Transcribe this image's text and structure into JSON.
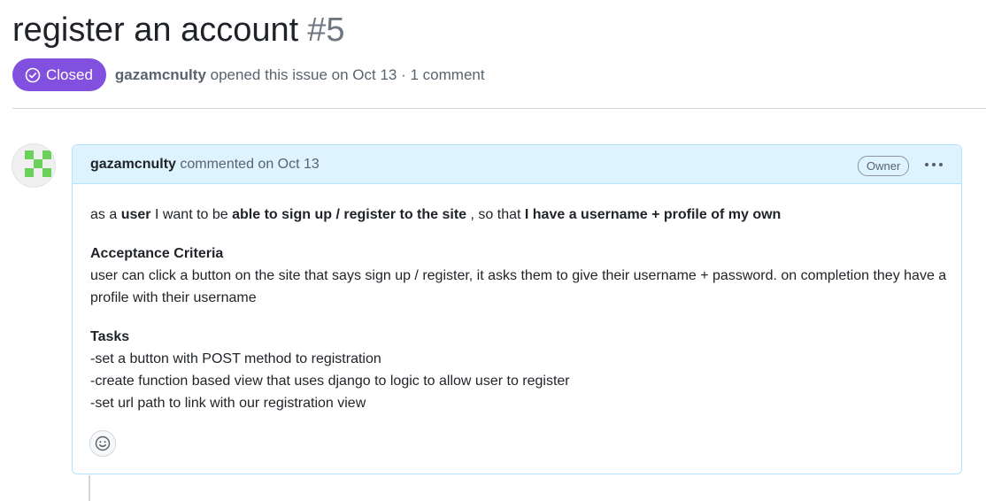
{
  "issue": {
    "title": "register an account",
    "number": "#5",
    "state": "Closed",
    "author": "gazamcnulty",
    "opened_text": "opened this issue on Oct 13 · 1 comment"
  },
  "comment": {
    "author": "gazamcnulty",
    "meta": "commented on Oct 13",
    "role_badge": "Owner",
    "more_icon": "kebab-horizontal-icon",
    "story": {
      "p1": "as a",
      "b1": "user",
      "p2": "I want to be",
      "b2": "able to sign up / register to the site",
      "p3": ", so that",
      "b3": "I have a username + profile of my own"
    },
    "criteria_heading": "Acceptance Criteria",
    "criteria_text": "user can click a button on the site that says sign up / register, it asks them to give their username + password. on completion they have a profile with their username",
    "tasks_heading": "Tasks",
    "tasks": [
      "-set a button with POST method to registration",
      "-create function based view that uses django to logic to allow user to register",
      "-set url path to link with our registration view"
    ],
    "reaction_icon": "smiley-icon"
  },
  "colors": {
    "closed_badge": "#8250df",
    "comment_header_bg": "#ddf4ff",
    "comment_border": "#b6e3ff",
    "avatar_green": "#6cd05c"
  }
}
